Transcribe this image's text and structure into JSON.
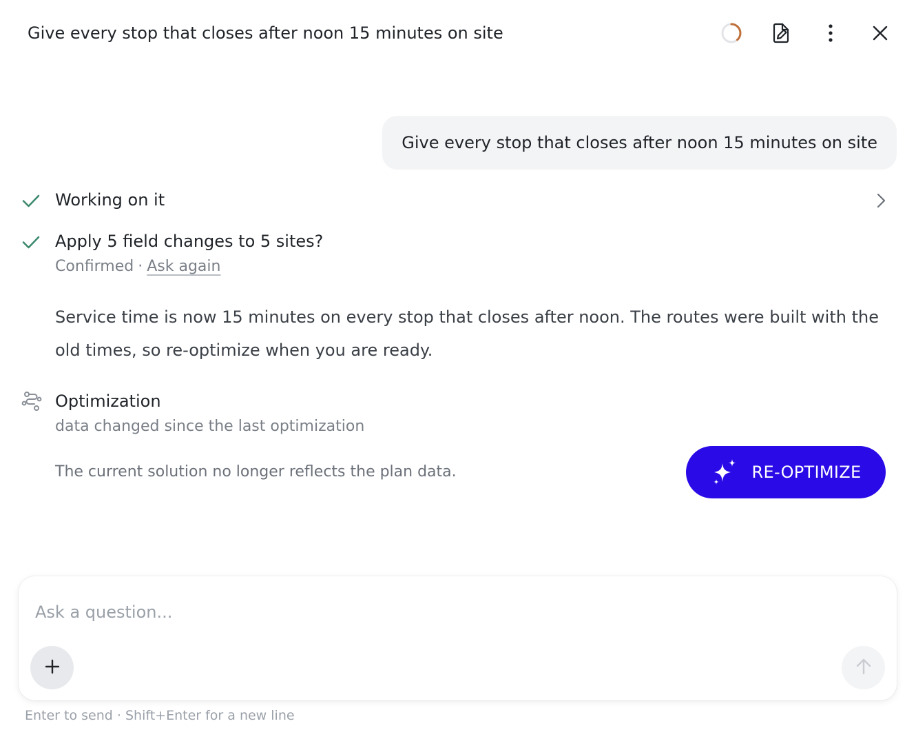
{
  "header": {
    "title": "Give every stop that closes after noon 15 minutes on site",
    "icons": [
      "spinner-icon",
      "file-edit-icon",
      "more-vertical-icon",
      "close-icon"
    ]
  },
  "conversation": {
    "user_message": "Give every stop that closes after noon 15 minutes on site",
    "steps": [
      {
        "title": "Working on it",
        "status": "done",
        "icon": "check-icon"
      },
      {
        "title": "Apply 5 field changes to 5 sites?",
        "status": "done",
        "icon": "check-icon",
        "confirmed_label": "Confirmed",
        "separator": "·",
        "ask_again_label": "Ask again"
      }
    ],
    "answer": "Service time is now 15 minutes on every stop that closes after noon. The routes were built with the old times, so re-optimize when you are ready.",
    "optimization": {
      "title": "Optimization",
      "subtitle": "data changed since the last optimization",
      "description": "The current solution no longer reflects the plan data.",
      "button_label": "RE-OPTIMIZE",
      "icon": "route-icon"
    }
  },
  "composer": {
    "placeholder": "Ask a question...",
    "hint": "Enter to send · Shift+Enter for a new line"
  },
  "colors": {
    "accent": "#2a0ae6",
    "check": "#3d8a6e",
    "spinner": "#c0703a",
    "bubble_bg": "#f3f4f6"
  }
}
